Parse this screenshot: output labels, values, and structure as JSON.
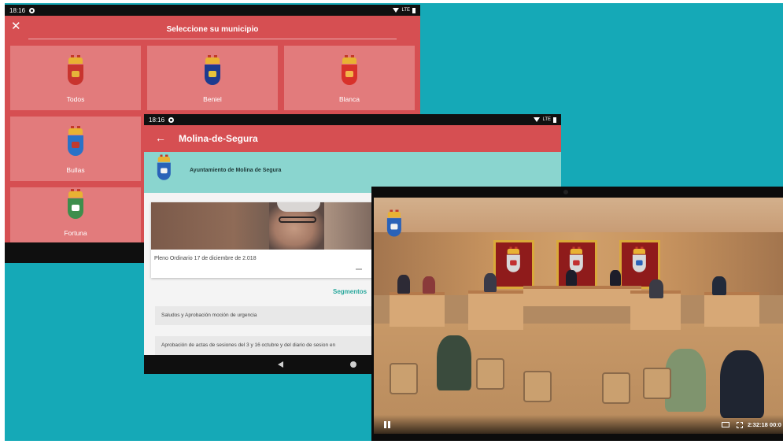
{
  "screen1": {
    "status_time": "18:16",
    "status_right": "LTE",
    "title": "Seleccione su municipio",
    "close_glyph": "✕",
    "tiles": [
      {
        "label": "Todos",
        "crest_color": "#c8342e",
        "mark_color": "#e6b33a"
      },
      {
        "label": "Beniel",
        "crest_color": "#1d3b8f",
        "mark_color": "#e6c23a"
      },
      {
        "label": "Blanca",
        "crest_color": "#d8312a",
        "mark_color": "#f3b54a"
      },
      {
        "label": "Bullas",
        "crest_color": "#2a72c7",
        "mark_color": "#c13a2e"
      },
      {
        "label": "Fortuna",
        "crest_color": "#3e8e4c",
        "mark_color": "#ffffff"
      }
    ]
  },
  "screen2": {
    "status_time": "18:16",
    "status_right": "LTE",
    "back_glyph": "←",
    "title": "Molina-de-Segura",
    "band_title": "Ayuntamiento de Molina de Segura",
    "video_caption": "Pleno Ordinario 17 de diciembre de 2.018",
    "segments_label": "Segmentos",
    "segments": [
      "Saludos y Aprobación moción de urgencia",
      "Aprobación de actas de sesiones del 3 y 16 octubre y del diario de sesion en"
    ]
  },
  "screen3": {
    "time_display": "2:32:18 00:0"
  },
  "colors": {
    "accent_red": "#d64f52",
    "teal_background": "#15a9b7",
    "mint_band": "#8ad5cf"
  }
}
